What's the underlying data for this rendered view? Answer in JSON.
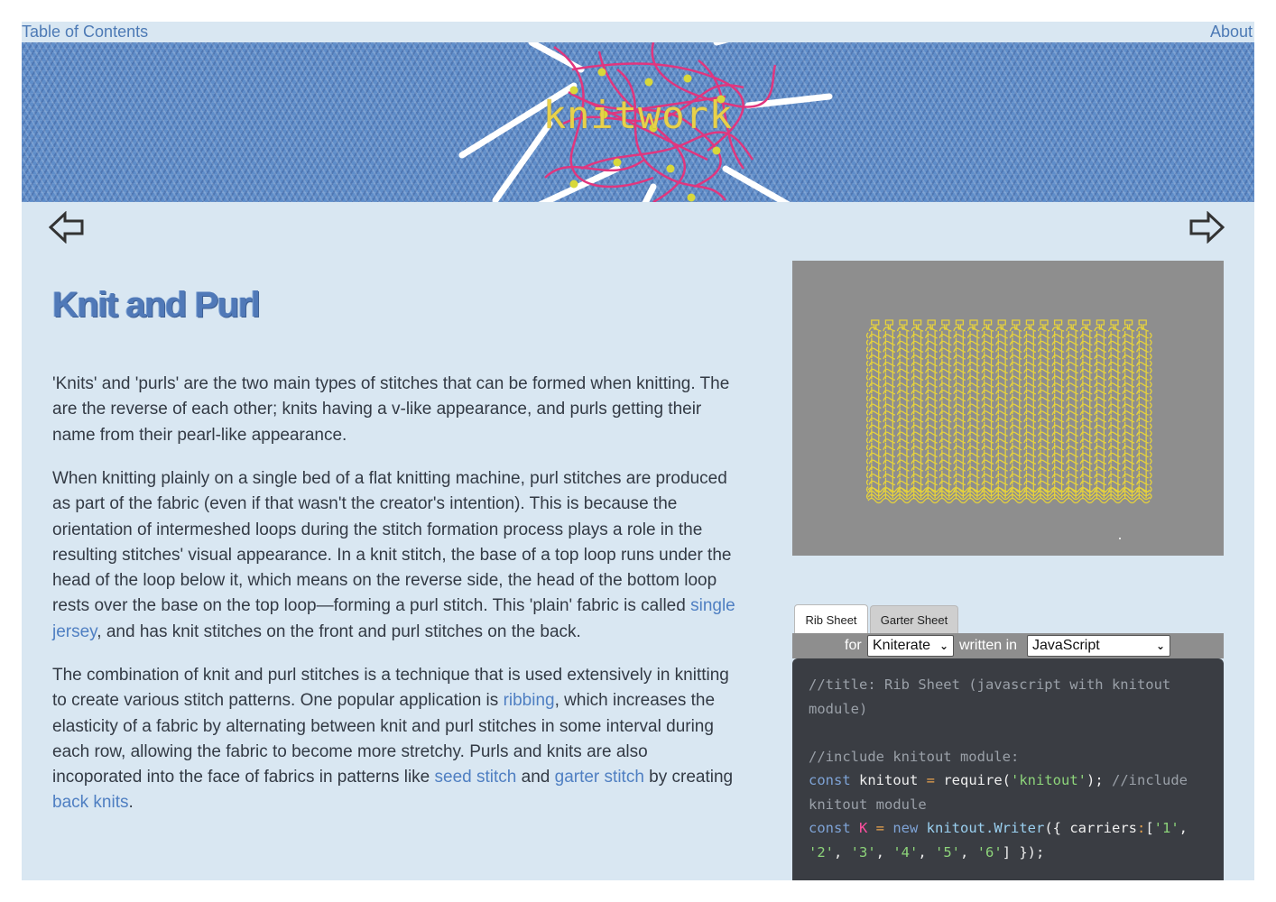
{
  "topnav": {
    "toc_label": "Table of Contents",
    "about_label": "About"
  },
  "banner": {
    "title": "knitwork"
  },
  "nav_arrows": {
    "prev_icon": "left-arrow-icon",
    "next_icon": "right-arrow-icon"
  },
  "article": {
    "heading": "Knit and Purl",
    "p1": "'Knits' and 'purls' are the two main types of stitches that can be formed when knitting. The are the reverse of each other; knits having a v-like appearance, and purls getting their name from their pearl-like appearance.",
    "p2_before": "When knitting plainly on a single bed of a flat knitting machine, purl stitches are produced as part of the fabric (even if that wasn't the creator's intention). This is because the orientation of intermeshed loops during the stitch formation process plays a role in the resulting stitches' visual appearance. In a knit stitch, the base of a top loop runs under the head of the loop below it, which means on the reverse side, the head of the bottom loop rests over the base on the top loop—forming a purl stitch. This 'plain' fabric is called ",
    "p2_link": "single jersey",
    "p2_after": ", and has knit stitches on the front and purl stitches on the back.",
    "p3_a": "The combination of knit and purl stitches is a technique that is used extensively in knitting to create various stitch patterns. One popular application is ",
    "p3_link1": "ribbing",
    "p3_b": ", which increases the elasticity of a fabric by alternating between knit and purl stitches in some interval during each row, allowing the fabric to become more stretchy. Purls and knits are also incoporated into the face of fabrics in patterns like ",
    "p3_link2": "seed stitch",
    "p3_c": " and ",
    "p3_link3": "garter stitch",
    "p3_d": " by creating ",
    "p3_link4": "back knits",
    "p3_e": "."
  },
  "visualization": {
    "yarn_color": "#e6d23c",
    "background": "#8e8e8e"
  },
  "tabs": [
    {
      "label": "Rib Sheet",
      "active": true
    },
    {
      "label": "Garter Sheet",
      "active": false
    }
  ],
  "selector": {
    "for_label": "for",
    "machine_value": "Kniterate",
    "written_label": "written in",
    "language_value": "JavaScript"
  },
  "code": {
    "l1": "//title: Rib Sheet (javascript with knitout module)",
    "l2": "//include knitout module:",
    "l3_kw": "const",
    "l3_name": " knitout ",
    "l3_op": "=",
    "l3_fn": " require(",
    "l3_str": "'knitout'",
    "l3_end": "); ",
    "l3_comment": "//include knitout module",
    "l4_kw": "const",
    "l4_var": " K ",
    "l4_op": "=",
    "l4_new": " new",
    "l4_fn": " knitout.Writer",
    "l4_open": "({ carriers",
    "l4_colon": ":",
    "l4_list_open": "[",
    "l4_s1": "'1'",
    "l4_s2": "'2'",
    "l4_s3": "'3'",
    "l4_s4": "'4'",
    "l4_s5": "'5'",
    "l4_s6": "'6'",
    "l4_close": "] });"
  },
  "colors": {
    "accent": "#4d7ab5",
    "page_bg": "#d9e7f2",
    "heading": "#5079b8"
  }
}
